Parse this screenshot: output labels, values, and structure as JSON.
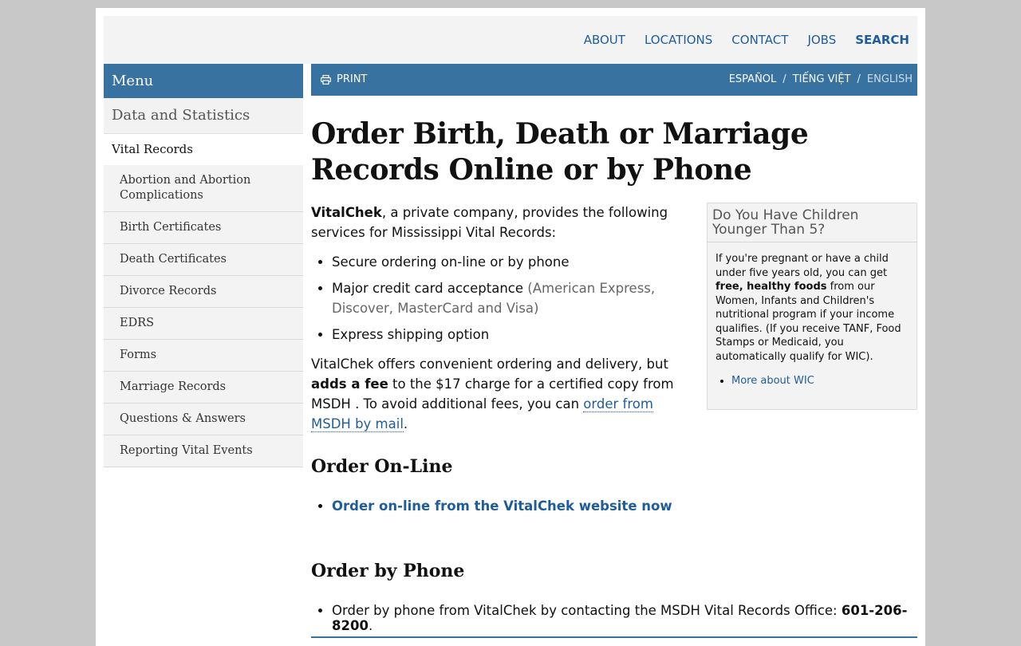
{
  "topnav": {
    "about": "ABOUT",
    "locations": "LOCATIONS",
    "contact": "CONTACT",
    "jobs": "JOBS",
    "search": "SEARCH"
  },
  "sidebar": {
    "menu_title": "Menu",
    "section": "Data and Statistics",
    "current": "Vital Records",
    "items": [
      "Abortion and Abortion Complications",
      "Birth Certificates",
      "Death Certificates",
      "Divorce Records",
      "EDRS",
      "Forms",
      "Marriage Records",
      "Questions & Answers",
      "Reporting Vital Events"
    ]
  },
  "toolbar": {
    "print": "PRINT",
    "lang_es": "ESPAÑOL",
    "lang_vi": "TIẾNG VIỆT",
    "lang_en": "ENGLISH",
    "separator": "/"
  },
  "main": {
    "title": "Order Birth, Death or Marriage Records Online or by Phone",
    "intro_strong": "VitalChek",
    "intro_rest": ", a private company, provides the following services for Mississippi Vital Records:",
    "bullets": {
      "b1": "Secure ordering on-line or by phone",
      "b2": "Major credit card acceptance",
      "b2_muted": "(American Express, Discover, MasterCard and Visa)",
      "b3": "Express shipping option"
    },
    "fee_p1": "VitalChek offers convenient ordering and delivery, but ",
    "fee_strong": "adds a fee",
    "fee_p2": " to the $17 charge for a certified copy from MSDH . To avoid additional fees, you can ",
    "fee_link": "order from MSDH by mail",
    "fee_end": ".",
    "online_heading": "Order On-Line",
    "online_link": "Order on-line from the VitalChek website now",
    "phone_heading": "Order by Phone",
    "phone_text": "Order by phone from VitalChek by contacting the MSDH Vital Records Office: ",
    "phone_number": "601-206-8200",
    "phone_end": "."
  },
  "aside": {
    "title": "Do You Have Children Younger Than 5?",
    "p1": "If you're pregnant or have a child under five years old, you can get ",
    "p_strong": "free, healthy foods",
    "p2": " from our Women, Infants and Children's nutritional program if your income qualifies. (If you receive TANF, Food Stamps or Medicaid, you automatically qualify for WIC).",
    "link": "More about WIC"
  },
  "colors": {
    "brand_blue": "#3872a1",
    "link_blue": "#1f5d9a"
  }
}
